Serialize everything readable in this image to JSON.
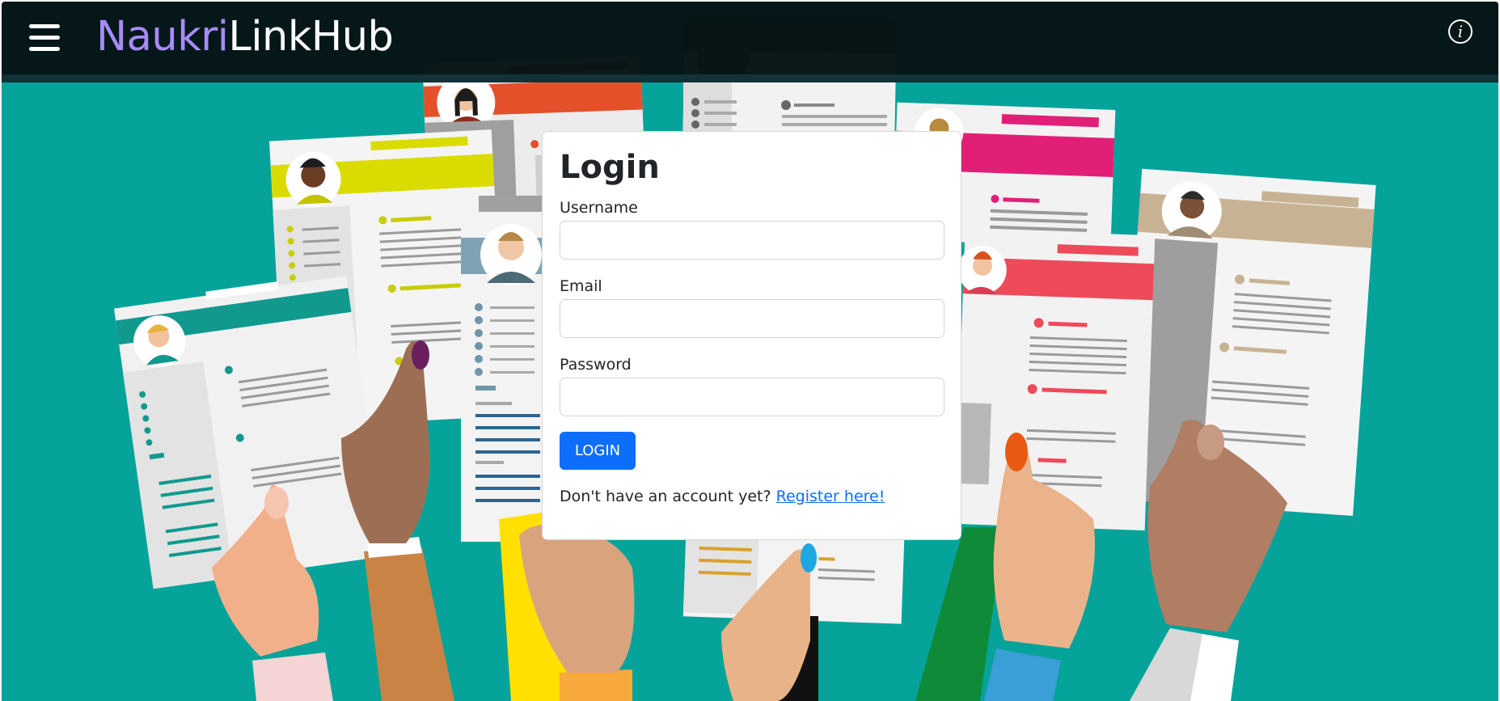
{
  "navbar": {
    "brand_part1": "Naukri",
    "brand_part2": "LinkHub",
    "menu_icon": "hamburger-menu-icon",
    "info_icon": "info-icon",
    "info_glyph": "i",
    "colors": {
      "background": "#071618",
      "brand_accent": "#a78bfa",
      "brand_text": "#ffffff"
    }
  },
  "login": {
    "title": "Login",
    "username_label": "Username",
    "username_value": "",
    "email_label": "Email",
    "email_value": "",
    "password_label": "Password",
    "password_value": "",
    "submit_label": "LOGIN",
    "register_prompt": "Don't have an account yet?",
    "register_link": "Register here!",
    "colors": {
      "primary": "#0d6efd"
    }
  },
  "background": {
    "color": "#05a39a",
    "illustration": "hands-holding-resumes-illustration"
  }
}
